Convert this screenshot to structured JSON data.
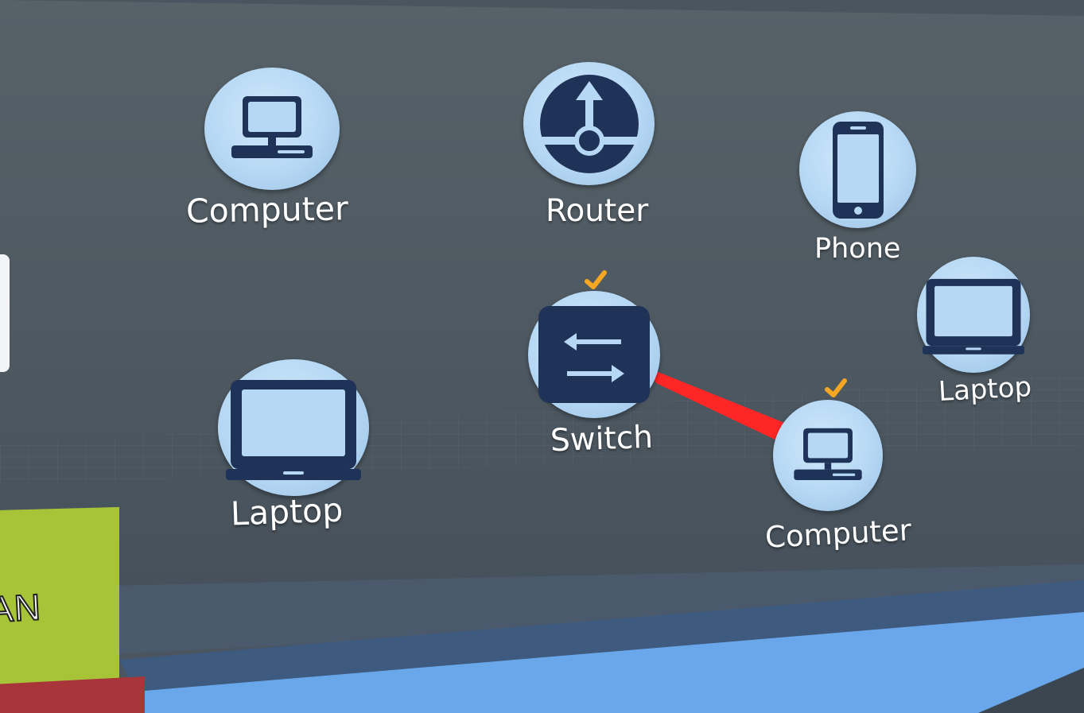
{
  "scene": {
    "nodes": [
      {
        "id": "computer-1",
        "label": "Computer",
        "icon": "desktop-icon",
        "selected": false
      },
      {
        "id": "router-1",
        "label": "Router",
        "icon": "router-icon",
        "selected": false
      },
      {
        "id": "phone-1",
        "label": "Phone",
        "icon": "phone-icon",
        "selected": false
      },
      {
        "id": "laptop-1",
        "label": "Laptop",
        "icon": "laptop-icon",
        "selected": false
      },
      {
        "id": "switch-1",
        "label": "Switch",
        "icon": "switch-icon",
        "selected": true
      },
      {
        "id": "computer-2",
        "label": "Computer",
        "icon": "desktop-icon",
        "selected": true
      },
      {
        "id": "laptop-2",
        "label": "Laptop",
        "icon": "laptop-icon",
        "selected": false
      }
    ],
    "connections": [
      {
        "from": "switch-1",
        "to": "computer-2",
        "color": "#ff2b2b"
      }
    ],
    "side_block": {
      "label": "AN",
      "color": "#a7c438"
    },
    "colors": {
      "panel": "#4f5a64",
      "floor_accent": "#6aa7ea",
      "check": "#f5a623",
      "node_fill": "#b6d8f4",
      "icon_dark": "#1f3358"
    }
  }
}
